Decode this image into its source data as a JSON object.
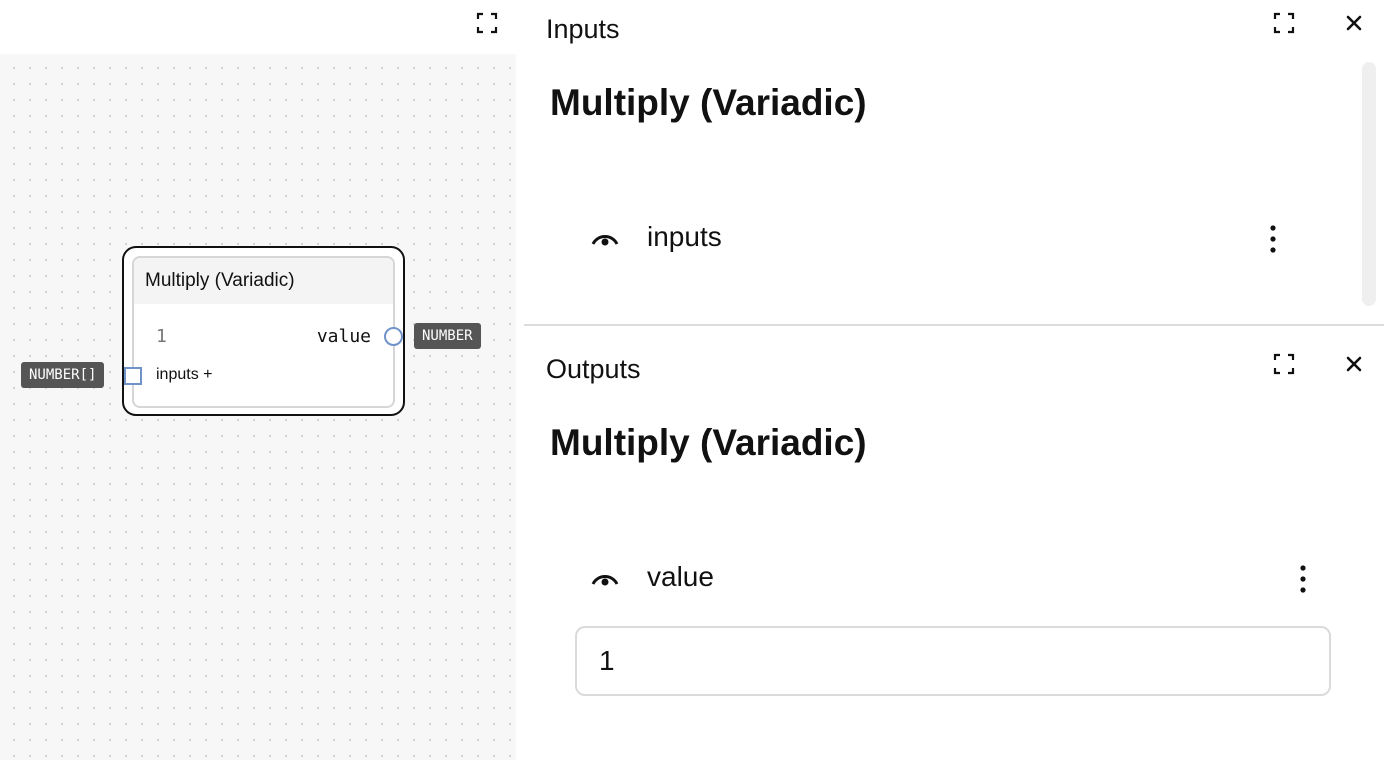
{
  "canvas": {
    "node": {
      "title": "Multiply (Variadic)",
      "output_value": "1",
      "output_label": "value",
      "input_label": "inputs +"
    },
    "output_type_badge": "NUMBER",
    "input_type_badge": "NUMBER[]",
    "icons": {
      "expand": "fullscreen-icon"
    }
  },
  "inputs_panel": {
    "title": "Inputs",
    "heading": "Multiply (Variadic)",
    "rows": [
      {
        "label": "inputs"
      }
    ],
    "icons": {
      "expand": "fullscreen-icon",
      "close": "close-icon",
      "eye": "eye-icon",
      "menu": "more-vertical-icon"
    }
  },
  "outputs_panel": {
    "title": "Outputs",
    "heading": "Multiply (Variadic)",
    "rows": [
      {
        "label": "value",
        "field_value": "1"
      }
    ],
    "icons": {
      "expand": "fullscreen-icon",
      "close": "close-icon",
      "eye": "eye-icon",
      "menu": "more-vertical-icon"
    }
  },
  "colors": {
    "port_blue": "#6f93c9",
    "badge_bg": "#555555",
    "canvas_bg": "#f7f7f7"
  }
}
